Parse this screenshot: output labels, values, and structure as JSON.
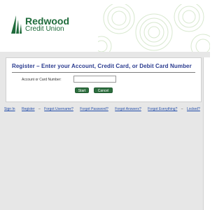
{
  "brand": {
    "name_line1": "Redwood",
    "name_line2": "Credit Union",
    "color": "#1f6b3b"
  },
  "registration": {
    "title": "Register – Enter your Account, Credit Card, or Debit Card Number",
    "field_label": "Account or Card Number:",
    "field_value": "",
    "start_label": "Start",
    "cancel_label": "Cancel"
  },
  "nav": {
    "sign_in": "Sign In",
    "register": "Register",
    "forgot_username": "Forgot Username?",
    "forgot_password": "Forgot Password?",
    "forgot_answers": "Forgot Answers?",
    "forgot_everything": "Forgot Everything?",
    "locked": "Locked?",
    "separator": "–"
  },
  "colors": {
    "accent_green": "#2d6e3e",
    "title_blue": "#2a3b8f",
    "link_blue": "#1f4aa8",
    "background_grey": "#e7e7e7"
  }
}
